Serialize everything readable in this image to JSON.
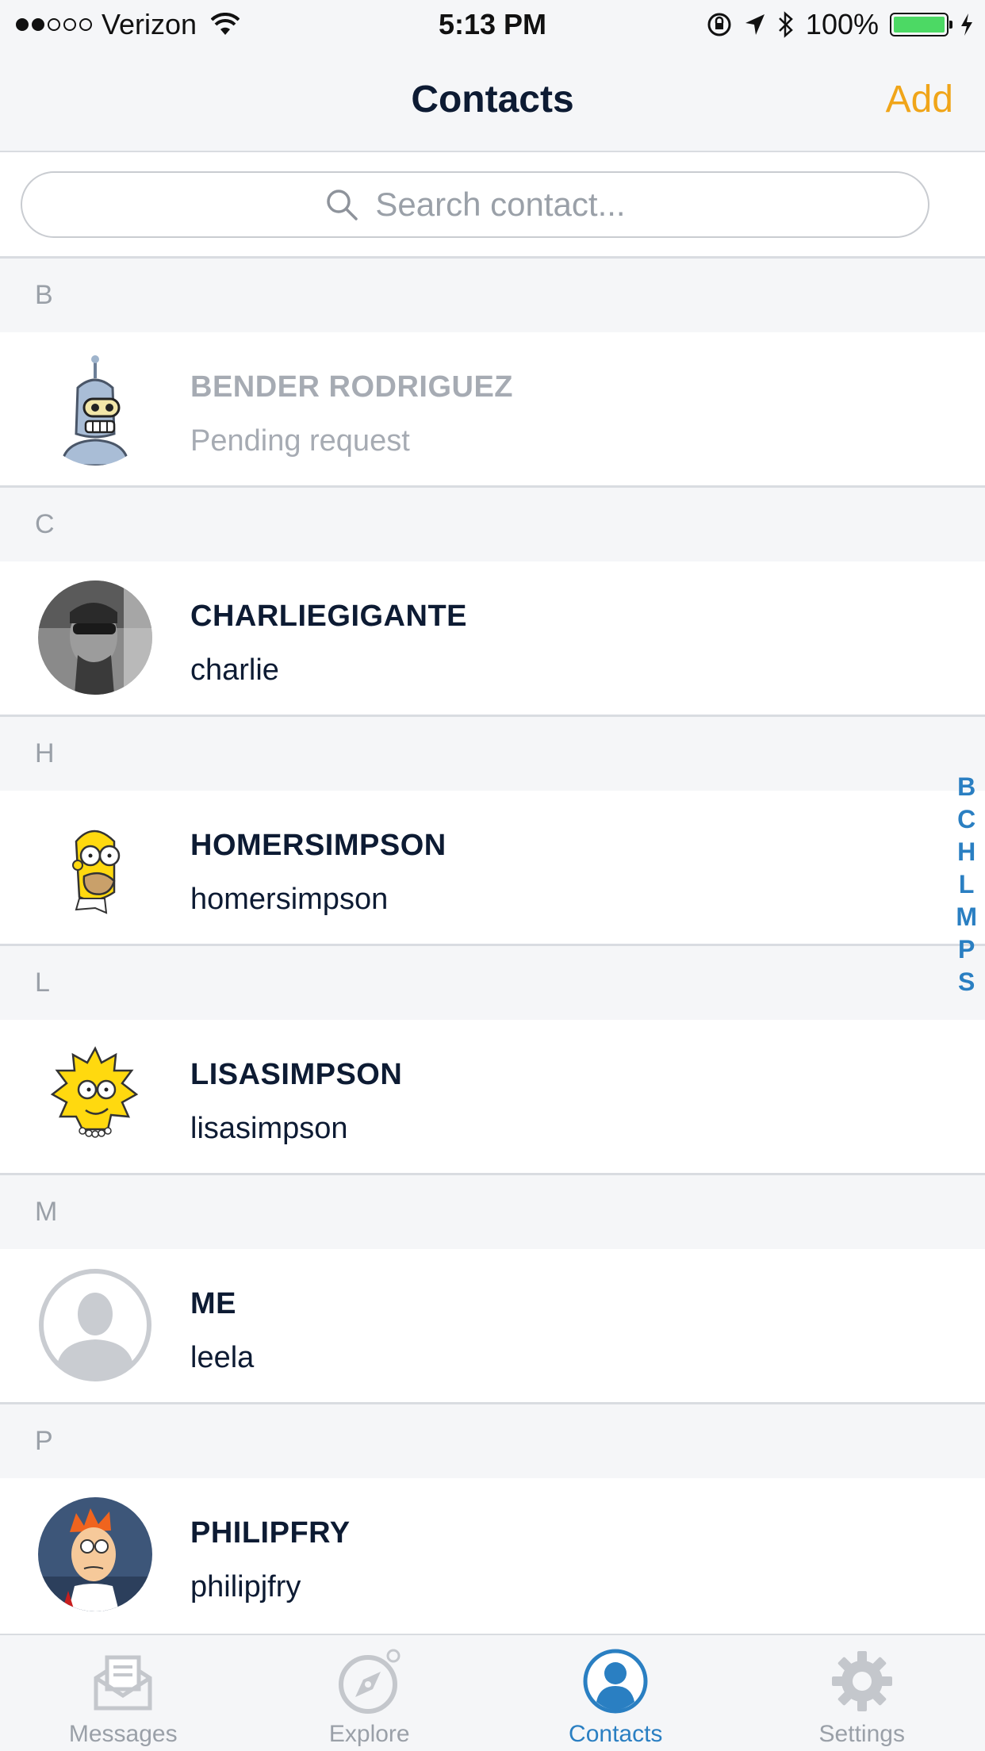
{
  "status_bar": {
    "carrier": "Verizon",
    "time": "5:13 PM",
    "battery": "100%"
  },
  "nav": {
    "title": "Contacts",
    "add_label": "Add"
  },
  "search": {
    "placeholder": "Search contact..."
  },
  "sections": [
    {
      "letter": "B",
      "name": "BENDER RODRIGUEZ",
      "sub": "Pending request"
    },
    {
      "letter": "C",
      "name": "CHARLIEGIGANTE",
      "sub": "charlie"
    },
    {
      "letter": "H",
      "name": "HOMERSIMPSON",
      "sub": "homersimpson"
    },
    {
      "letter": "L",
      "name": "LISASIMPSON",
      "sub": "lisasimpson"
    },
    {
      "letter": "M",
      "name": "ME",
      "sub": "leela"
    },
    {
      "letter": "P",
      "name": "PHILIPFRY",
      "sub": "philipjfry"
    }
  ],
  "index_letters": [
    "B",
    "C",
    "H",
    "L",
    "M",
    "P",
    "S"
  ],
  "tabs": [
    {
      "label": "Messages",
      "icon": "envelope-icon"
    },
    {
      "label": "Explore",
      "icon": "compass-icon"
    },
    {
      "label": "Contacts",
      "icon": "person-icon"
    },
    {
      "label": "Settings",
      "icon": "gear-icon"
    }
  ],
  "colors": {
    "accent_add": "#f0a519",
    "active_tab": "#2a7fc2",
    "index": "#2a7fc2"
  }
}
